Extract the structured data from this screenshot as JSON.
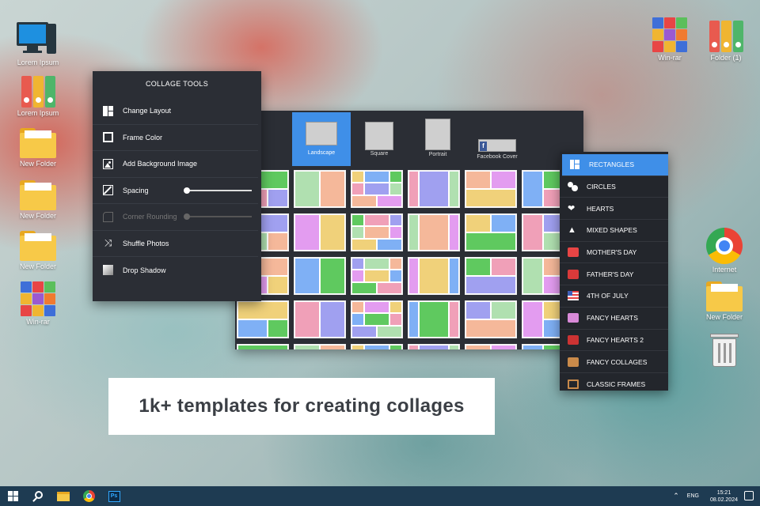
{
  "desktop": {
    "left_icons": [
      {
        "label": "Lorem Ipsum",
        "type": "computer"
      },
      {
        "label": "Lorem Ipsum",
        "type": "binders"
      },
      {
        "label": "New Folder",
        "type": "folder"
      },
      {
        "label": "New Folder",
        "type": "folder"
      },
      {
        "label": "New Folder",
        "type": "folder"
      },
      {
        "label": "Win-rar",
        "type": "winrar"
      }
    ],
    "right_icons": [
      {
        "label": "Win-rar",
        "type": "winrar"
      },
      {
        "label": "Folder (1)",
        "type": "binders"
      },
      {
        "label": "Internet",
        "type": "chrome"
      },
      {
        "label": "New Folder",
        "type": "folder"
      },
      {
        "label": "",
        "type": "trash"
      }
    ]
  },
  "collage_tools": {
    "title": "COLLAGE TOOLS",
    "items": [
      {
        "label": "Change Layout",
        "icon": "layout-icon",
        "enabled": true
      },
      {
        "label": "Frame Color",
        "icon": "frame-icon",
        "enabled": true
      },
      {
        "label": "Add Background Image",
        "icon": "image-icon",
        "enabled": true
      },
      {
        "label": "Spacing",
        "icon": "resize-icon",
        "enabled": true,
        "slider": 0.0
      },
      {
        "label": "Corner Rounding",
        "icon": "corner-icon",
        "enabled": false,
        "slider": 0.0
      },
      {
        "label": "Shuffle Photos",
        "icon": "shuffle-icon",
        "enabled": true
      },
      {
        "label": "Drop Shadow",
        "icon": "shadow-icon",
        "enabled": true
      }
    ]
  },
  "formats": [
    {
      "label": "Landscape",
      "active": true
    },
    {
      "label": "Square",
      "active": false
    },
    {
      "label": "Portrait",
      "active": false
    },
    {
      "label": "Facebook Cover",
      "active": false
    }
  ],
  "shape_categories": [
    {
      "label": "RECTANGLES",
      "active": true
    },
    {
      "label": "CIRCLES",
      "active": false
    },
    {
      "label": "HEARTS",
      "active": false
    },
    {
      "label": "MIXED SHAPES",
      "active": false
    },
    {
      "label": "MOTHER'S DAY",
      "active": false
    },
    {
      "label": "FATHER'S DAY",
      "active": false
    },
    {
      "label": "4TH OF JULY",
      "active": false
    },
    {
      "label": "FANCY HEARTS",
      "active": false
    },
    {
      "label": "FANCY HEARTS 2",
      "active": false
    },
    {
      "label": "FANCY COLLAGES",
      "active": false
    },
    {
      "label": "CLASSIC FRAMES",
      "active": false
    }
  ],
  "caption": "1k+ templates for creating collages",
  "colors": {
    "accent": "#3f8fe8",
    "panel": "#2b2e35",
    "tiles": [
      "#e39cf0",
      "#f0d17a",
      "#7fb0f5",
      "#5fc95f",
      "#f0a0b8",
      "#a0a0f0",
      "#b0e0b0",
      "#f5b89a"
    ]
  },
  "taskbar": {
    "apps": [
      "start-icon",
      "search-icon",
      "file-explorer-icon",
      "chrome-icon",
      "photoshop-icon"
    ],
    "ps_label": "Ps",
    "lang": "ENG",
    "time": "15:21",
    "date": "08.02.2024"
  }
}
